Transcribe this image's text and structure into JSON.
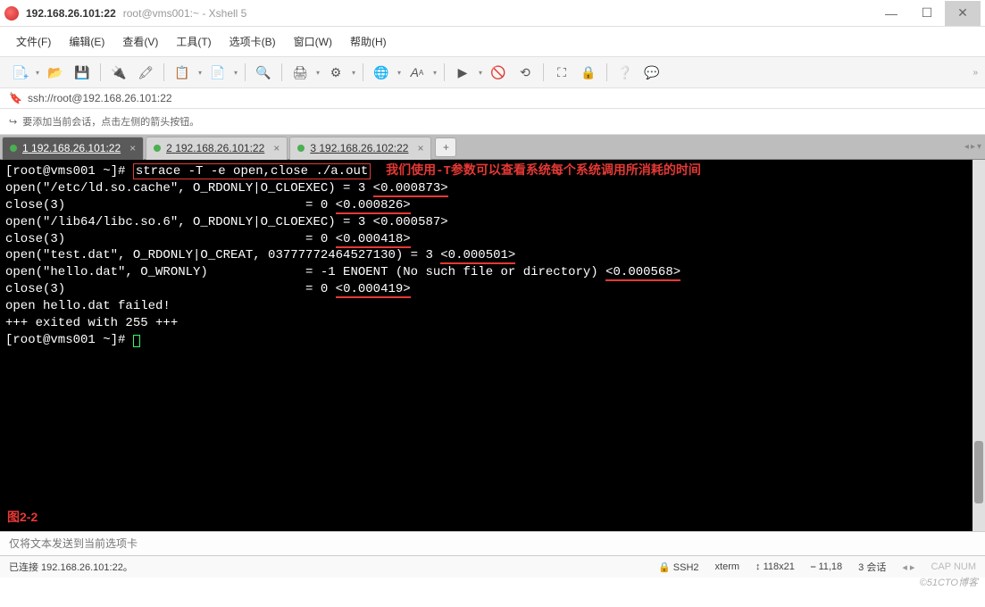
{
  "titlebar": {
    "ip": "192.168.26.101:22",
    "subtitle": "root@vms001:~ - Xshell 5"
  },
  "menu": {
    "file": "文件(F)",
    "edit": "编辑(E)",
    "view": "查看(V)",
    "tools": "工具(T)",
    "tab": "选项卡(B)",
    "window": "窗口(W)",
    "help": "帮助(H)"
  },
  "addressbar": {
    "url": "ssh://root@192.168.26.101:22"
  },
  "hintbar": {
    "text": "要添加当前会话，点击左侧的箭头按钮。"
  },
  "tabs": {
    "t1": {
      "num": "1",
      "label": "192.168.26.101:22"
    },
    "t2": {
      "num": "2",
      "label": "192.168.26.101:22"
    },
    "t3": {
      "num": "3",
      "label": "192.168.26.102:22"
    },
    "add": "+"
  },
  "terminal": {
    "prompt1": "[root@vms001 ~]# ",
    "cmd": "strace -T -e open,close ./a.out",
    "annot": "我们使用-T参数可以查看系统每个系统调用所消耗的时间",
    "l2a": "open(\"/etc/ld.so.cache\", O_RDONLY|O_CLOEXEC) = 3 ",
    "l2b": "<0.000873>",
    "l3a": "close(3)                                = 0 ",
    "l3b": "<0.000826>",
    "l4": "open(\"/lib64/libc.so.6\", O_RDONLY|O_CLOEXEC) = 3 <0.000587>",
    "l5a": "close(3)                                = 0 ",
    "l5b": "<0.000418>",
    "l6a": "open(\"test.dat\", O_RDONLY|O_CREAT, 03777772464527130) = 3 ",
    "l6b": "<0.000501>",
    "l7a": "open(\"hello.dat\", O_WRONLY)             = -1 ENOENT (No such file or directory) ",
    "l7b": "<0.000568>",
    "l8a": "close(3)                                = 0 ",
    "l8b": "<0.000419>",
    "l9": "open hello.dat failed!",
    "l10": "+++ exited with 255 +++",
    "prompt2": "[root@vms001 ~]# ",
    "fig": "图2-2"
  },
  "sendbar": {
    "placeholder": "仅将文本发送到当前选项卡"
  },
  "status": {
    "conn": "已连接 192.168.26.101:22。",
    "proto": "SSH2",
    "term": "xterm",
    "size": "118x21",
    "pos": "11,18",
    "sessions": "3 会话"
  },
  "watermark": "©51CTO博客"
}
